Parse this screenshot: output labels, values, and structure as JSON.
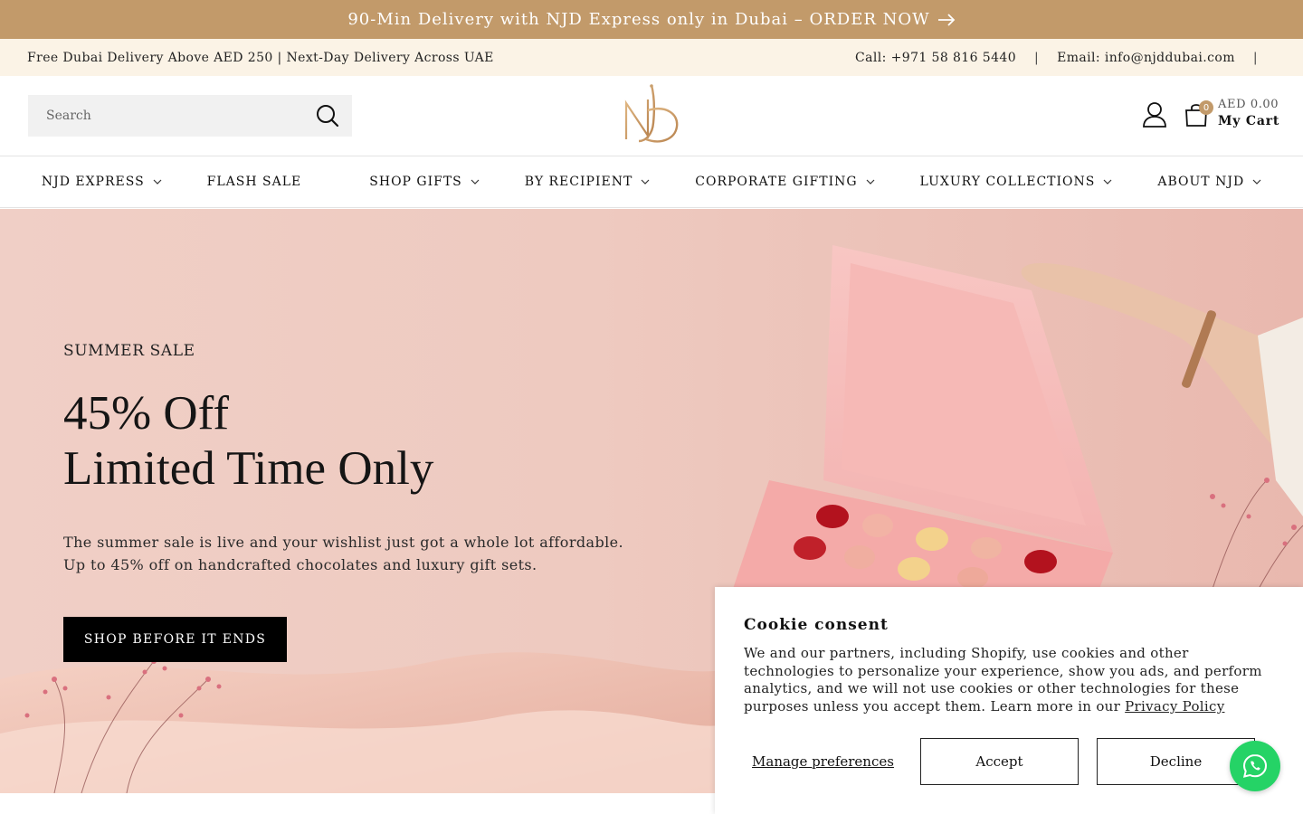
{
  "announcement": {
    "text": "90-Min Delivery with NJD Express only in Dubai – ORDER NOW"
  },
  "infobar": {
    "left_text": "Free Dubai Delivery Above AED 250 | Next-Day Delivery Across UAE",
    "phone": "Call: +971 58 816 5440",
    "separator": "|",
    "email": "Email: info@njddubai.com"
  },
  "header": {
    "search_placeholder": "Search",
    "logo_alt": "NJD",
    "cart_count": "0",
    "cart_amount": "AED 0.00",
    "cart_label": "My Cart"
  },
  "nav": {
    "items": [
      {
        "label": "NJD EXPRESS",
        "has_dropdown": true
      },
      {
        "label": "FLASH SALE",
        "has_dropdown": false
      },
      {
        "label": "SHOP GIFTS",
        "has_dropdown": true
      },
      {
        "label": "BY RECIPIENT",
        "has_dropdown": true
      },
      {
        "label": "CORPORATE GIFTING",
        "has_dropdown": true
      },
      {
        "label": "LUXURY COLLECTIONS",
        "has_dropdown": true
      },
      {
        "label": "ABOUT NJD",
        "has_dropdown": true
      }
    ]
  },
  "hero": {
    "eyebrow": "SUMMER SALE",
    "headline_line1": "45% Off",
    "headline_line2": "Limited Time Only",
    "body_line1": "The summer sale is live and your wishlist just got a whole lot affordable.",
    "body_line2": "Up to 45% off on handcrafted chocolates and luxury gift sets.",
    "cta": "SHOP BEFORE IT ENDS"
  },
  "cookie": {
    "title": "Cookie consent",
    "body": "We and our partners, including Shopify, use cookies and other technologies to personalize your experience, show you ads, and perform analytics, and we will not use cookies or other technologies for these purposes unless you accept them. Learn more in our ",
    "link": "Privacy Policy",
    "manage": "Manage preferences",
    "accept": "Accept",
    "decline": "Decline"
  },
  "colors": {
    "brand_gold": "#c29a6a",
    "info_bg": "#fbf3e6",
    "cta_bg": "#000000",
    "whatsapp": "#25d366"
  }
}
